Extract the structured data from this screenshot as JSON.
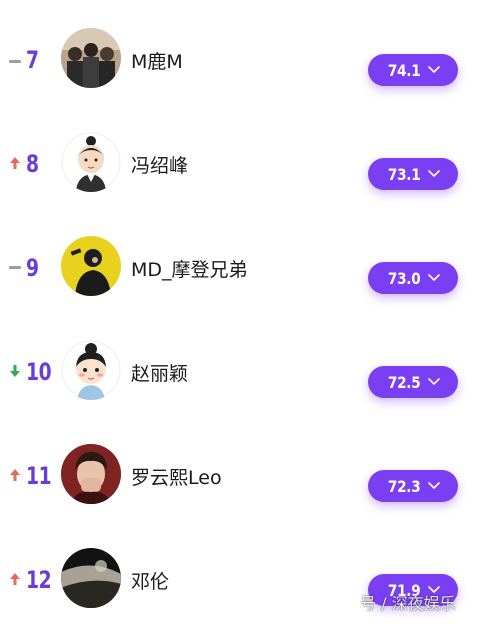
{
  "ranking": {
    "rows": [
      {
        "rank": "7",
        "trend": "same",
        "name": "M鹿M",
        "score": "74.1",
        "avatar_icon": "group-photo-avatar"
      },
      {
        "rank": "8",
        "trend": "up",
        "name": "冯绍峰",
        "score": "73.1",
        "avatar_icon": "cartoon-man-avatar"
      },
      {
        "rank": "9",
        "trend": "same",
        "name": "MD_摩登兄弟",
        "score": "73.0",
        "avatar_icon": "yellow-portrait-avatar"
      },
      {
        "rank": "10",
        "trend": "down",
        "name": "赵丽颖",
        "score": "72.5",
        "avatar_icon": "cartoon-girl-avatar"
      },
      {
        "rank": "11",
        "trend": "up",
        "name": "罗云熙Leo",
        "score": "72.3",
        "avatar_icon": "portrait-avatar"
      },
      {
        "rank": "12",
        "trend": "up",
        "name": "邓伦",
        "score": "71.9",
        "avatar_icon": "landscape-avatar"
      }
    ]
  },
  "colors": {
    "accent": "#7a3ff2",
    "rank_text": "#6c3bdc",
    "trend_up": "#e46a5f",
    "trend_down": "#34a853",
    "trend_same": "#9e9e9e"
  },
  "watermark": {
    "text": "号 / 深夜娱乐"
  }
}
